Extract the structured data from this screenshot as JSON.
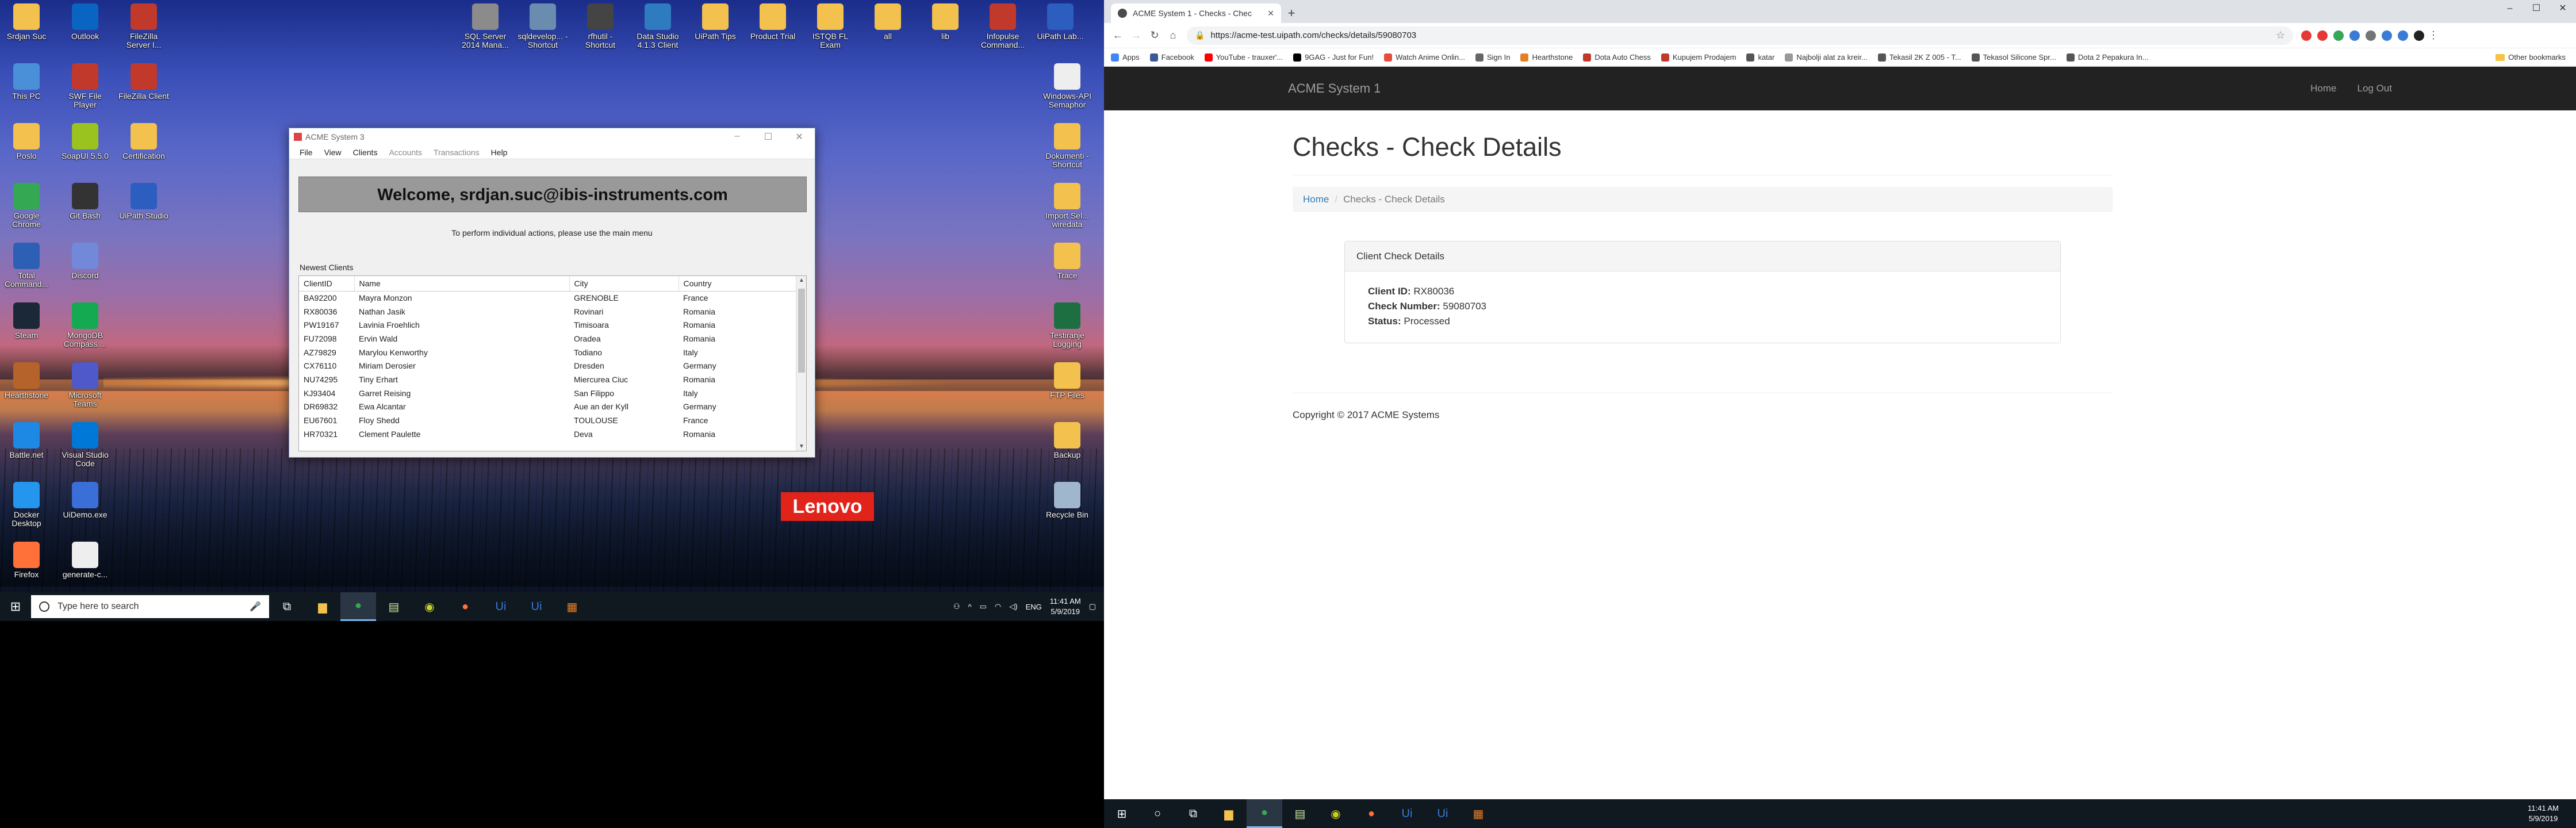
{
  "left_desktop": {
    "icons_col1": [
      {
        "label": "Srdjan Suc",
        "icon": "user-folder-icon",
        "color": "#f2c14e"
      },
      {
        "label": "This PC",
        "icon": "computer-icon",
        "color": "#4a90d9"
      },
      {
        "label": "Poslo",
        "icon": "folder-icon",
        "color": "#f2c14e"
      },
      {
        "label": "Google Chrome",
        "icon": "chrome-icon",
        "color": "#34a853"
      },
      {
        "label": "Total Command...",
        "icon": "total-commander-icon",
        "color": "#2d5fb5"
      },
      {
        "label": "Steam",
        "icon": "steam-icon",
        "color": "#1b2838"
      },
      {
        "label": "Hearthstone",
        "icon": "hearthstone-icon",
        "color": "#b5632b"
      },
      {
        "label": "Battle.net",
        "icon": "battlenet-icon",
        "color": "#1e88e5"
      },
      {
        "label": "Docker Desktop",
        "icon": "docker-icon",
        "color": "#2496ed"
      },
      {
        "label": "Firefox",
        "icon": "firefox-icon",
        "color": "#ff7139"
      }
    ],
    "icons_col2": [
      {
        "label": "Outlook",
        "icon": "outlook-icon",
        "color": "#0a64c1"
      },
      {
        "label": "SWF File Player",
        "icon": "swf-player-icon",
        "color": "#c0392b"
      },
      {
        "label": "SoapUI 5.5.0",
        "icon": "soapui-icon",
        "color": "#9bc31f"
      },
      {
        "label": "Git Bash",
        "icon": "git-bash-icon",
        "color": "#333333"
      },
      {
        "label": "Discord",
        "icon": "discord-icon",
        "color": "#7289da"
      },
      {
        "label": "MongoDB Compass ...",
        "icon": "mongodb-icon",
        "color": "#13aa52"
      },
      {
        "label": "Microsoft Teams",
        "icon": "teams-icon",
        "color": "#5059c9"
      },
      {
        "label": "Visual Studio Code",
        "icon": "vscode-icon",
        "color": "#0078d7"
      },
      {
        "label": "UiDemo.exe",
        "icon": "uidemo-icon",
        "color": "#3a6fd8"
      },
      {
        "label": "generate-c...",
        "icon": "file-icon",
        "color": "#eeeeee"
      }
    ],
    "icons_col3": [
      {
        "label": "FileZilla Server I...",
        "icon": "filezilla-server-icon",
        "color": "#c0392b"
      },
      {
        "label": "FileZilla Client",
        "icon": "filezilla-client-icon",
        "color": "#c0392b"
      },
      {
        "label": "Certification",
        "icon": "folder-icon",
        "color": "#f2c14e"
      },
      {
        "label": "UiPath Studio",
        "icon": "uipath-icon",
        "color": "#2b5ebe"
      }
    ],
    "icons_top": [
      {
        "label": "SQL Server 2014 Mana...",
        "icon": "sql-server-icon",
        "color": "#8b8b8b"
      },
      {
        "label": "sqldevelop... - Shortcut",
        "icon": "sql-developer-icon",
        "color": "#6a8caf"
      },
      {
        "label": "rfhutil - Shortcut",
        "icon": "rfhutil-icon",
        "color": "#444444"
      },
      {
        "label": "Data Studio 4.1.3 Client",
        "icon": "data-studio-icon",
        "color": "#2f7bbf"
      },
      {
        "label": "UiPath Tips",
        "icon": "folder-icon",
        "color": "#f2c14e"
      },
      {
        "label": "Product Trial",
        "icon": "folder-icon",
        "color": "#f2c14e"
      },
      {
        "label": "ISTQB FL Exam",
        "icon": "folder-icon",
        "color": "#f2c14e"
      },
      {
        "label": "all",
        "icon": "folder-icon",
        "color": "#f2c14e"
      },
      {
        "label": "lib",
        "icon": "folder-icon",
        "color": "#f2c14e"
      },
      {
        "label": "Infopulse Command...",
        "icon": "infopulse-icon",
        "color": "#c0392b"
      },
      {
        "label": "UiPath Lab...",
        "icon": "uipath-lab-icon",
        "color": "#2b5ebe"
      }
    ],
    "icons_right": [
      {
        "label": "Windows-API Semaphor",
        "icon": "file-icon",
        "color": "#eeeeee"
      },
      {
        "label": "Dokumenti - Shortcut",
        "icon": "folder-icon",
        "color": "#f2c14e"
      },
      {
        "label": "Import Sel... wiredata",
        "icon": "folder-icon",
        "color": "#f2c14e"
      },
      {
        "label": "Trace",
        "icon": "folder-icon",
        "color": "#f2c14e"
      },
      {
        "label": "Testiranje Logging",
        "icon": "excel-icon",
        "color": "#1d6f42"
      },
      {
        "label": "FTP Files",
        "icon": "folder-icon",
        "color": "#f2c14e"
      },
      {
        "label": "Backup",
        "icon": "folder-icon",
        "color": "#f2c14e"
      },
      {
        "label": "Recycle Bin",
        "icon": "recycle-bin-icon",
        "color": "#9fb6cd"
      }
    ],
    "brand": "Lenovo"
  },
  "acme_app": {
    "title": "ACME System 3",
    "menu": [
      "File",
      "View",
      "Clients",
      "Accounts",
      "Transactions",
      "Help"
    ],
    "welcome": "Welcome, srdjan.suc@ibis-instruments.com",
    "instructions": "To perform individual actions, please use the main menu",
    "newest_label": "Newest Clients",
    "columns": [
      "ClientID",
      "Name",
      "City",
      "Country"
    ],
    "rows": [
      [
        "BA92200",
        "Mayra Monzon",
        "GRENOBLE",
        "France"
      ],
      [
        "RX80036",
        "Nathan Jasik",
        "Rovinari",
        "Romania"
      ],
      [
        "PW19167",
        "Lavinia Froehlich",
        "Timisoara",
        "Romania"
      ],
      [
        "FU72098",
        "Ervin Wald",
        "Oradea",
        "Romania"
      ],
      [
        "AZ79829",
        "Marylou Kenworthy",
        "Todiano",
        "Italy"
      ],
      [
        "CX76110",
        "Miriam Derosier",
        "Dresden",
        "Germany"
      ],
      [
        "NU74295",
        "Tiny Erhart",
        "Miercurea Ciuc",
        "Romania"
      ],
      [
        "KJ93404",
        "Garret Reising",
        "San Filippo",
        "Italy"
      ],
      [
        "DR69832",
        "Ewa Alcantar",
        "Aue an der Kyll",
        "Germany"
      ],
      [
        "EU67601",
        "Floy Shedd",
        "TOULOUSE",
        "France"
      ],
      [
        "HR70321",
        "Clement Paulette",
        "Deva",
        "Romania"
      ]
    ]
  },
  "left_taskbar": {
    "search_placeholder": "Type here to search",
    "apps": [
      {
        "icon": "task-view-icon",
        "glyph": "⧉",
        "color": "#ffffff"
      },
      {
        "icon": "file-explorer-icon",
        "glyph": "▆",
        "color": "#f2c14e"
      },
      {
        "icon": "chrome-icon",
        "glyph": "●",
        "color": "#34a853"
      },
      {
        "icon": "notepad-icon",
        "glyph": "▤",
        "color": "#c8e6a0"
      },
      {
        "icon": "soapui-icon",
        "glyph": "◉",
        "color": "#c8d11f"
      },
      {
        "icon": "firefox-icon",
        "glyph": "●",
        "color": "#ff7139"
      },
      {
        "icon": "uipath-studio-icon",
        "glyph": "Ui",
        "color": "#3a7bd5"
      },
      {
        "icon": "uipath-robot-icon",
        "glyph": "Ui",
        "color": "#3a7bd5"
      },
      {
        "icon": "acme-app-icon",
        "glyph": "▦",
        "color": "#e67e22"
      }
    ],
    "tray_lang": "ENG",
    "time": "11:41 AM",
    "date": "5/9/2019"
  },
  "browser": {
    "tab_title": "ACME System 1 - Checks - Chec",
    "url": "https://acme-test.uipath.com/checks/details/59080703",
    "bookmarks": [
      {
        "label": "Apps",
        "color": "#4285f4"
      },
      {
        "label": "Facebook",
        "color": "#3b5998"
      },
      {
        "label": "YouTube - trauxer'...",
        "color": "#ff0000"
      },
      {
        "label": "9GAG - Just for Fun!",
        "color": "#000000"
      },
      {
        "label": "Watch Anime Onlin...",
        "color": "#e74c3c"
      },
      {
        "label": "Sign In",
        "color": "#666666"
      },
      {
        "label": "Hearthstone",
        "color": "#e67e22"
      },
      {
        "label": "Dota Auto Chess",
        "color": "#c0392b"
      },
      {
        "label": "Kupujem Prodajem",
        "color": "#c0392b"
      },
      {
        "label": "katar",
        "color": "#555555"
      },
      {
        "label": "Najbolji alat za kreir...",
        "color": "#999999"
      },
      {
        "label": "Tekasil 2K Z 005 - T...",
        "color": "#555555"
      },
      {
        "label": "Tekasol Silicone Spr...",
        "color": "#555555"
      },
      {
        "label": "Dota 2 Pepakura In...",
        "color": "#555555"
      }
    ],
    "other_bookmarks": "Other bookmarks",
    "ext_colors": [
      "#e53935",
      "#e53935",
      "#34a853",
      "#3a7bd5",
      "#757575",
      "#3a7bd5",
      "#3a7bd5",
      "#222222"
    ]
  },
  "site": {
    "brand": "ACME System 1",
    "nav_home": "Home",
    "nav_logout": "Log Out",
    "page_title": "Checks - Check Details",
    "breadcrumb_home": "Home",
    "breadcrumb_current": "Checks - Check Details",
    "panel_title": "Client Check Details",
    "client_id_label": "Client ID:",
    "client_id": "RX80036",
    "check_number_label": "Check Number:",
    "check_number": "59080703",
    "status_label": "Status:",
    "status": "Processed",
    "footer": "Copyright © 2017 ACME Systems"
  },
  "right_taskbar": {
    "apps": [
      {
        "icon": "windows-start-icon",
        "glyph": "⊞",
        "color": "#ffffff"
      },
      {
        "icon": "cortana-icon",
        "glyph": "○",
        "color": "#ffffff"
      },
      {
        "icon": "task-view-icon",
        "glyph": "⧉",
        "color": "#ffffff"
      },
      {
        "icon": "file-explorer-icon",
        "glyph": "▆",
        "color": "#f2c14e"
      },
      {
        "icon": "chrome-icon",
        "glyph": "●",
        "color": "#34a853"
      },
      {
        "icon": "notepad-icon",
        "glyph": "▤",
        "color": "#c8e6a0"
      },
      {
        "icon": "soapui-icon",
        "glyph": "◉",
        "color": "#c8d11f"
      },
      {
        "icon": "firefox-icon",
        "glyph": "●",
        "color": "#ff7139"
      },
      {
        "icon": "uipath-studio-icon",
        "glyph": "Ui",
        "color": "#3a7bd5"
      },
      {
        "icon": "uipath-robot-icon",
        "glyph": "Ui",
        "color": "#3a7bd5"
      },
      {
        "icon": "acme-app-icon",
        "glyph": "▦",
        "color": "#e67e22"
      }
    ],
    "time": "11:41 AM",
    "date": "5/9/2019"
  }
}
